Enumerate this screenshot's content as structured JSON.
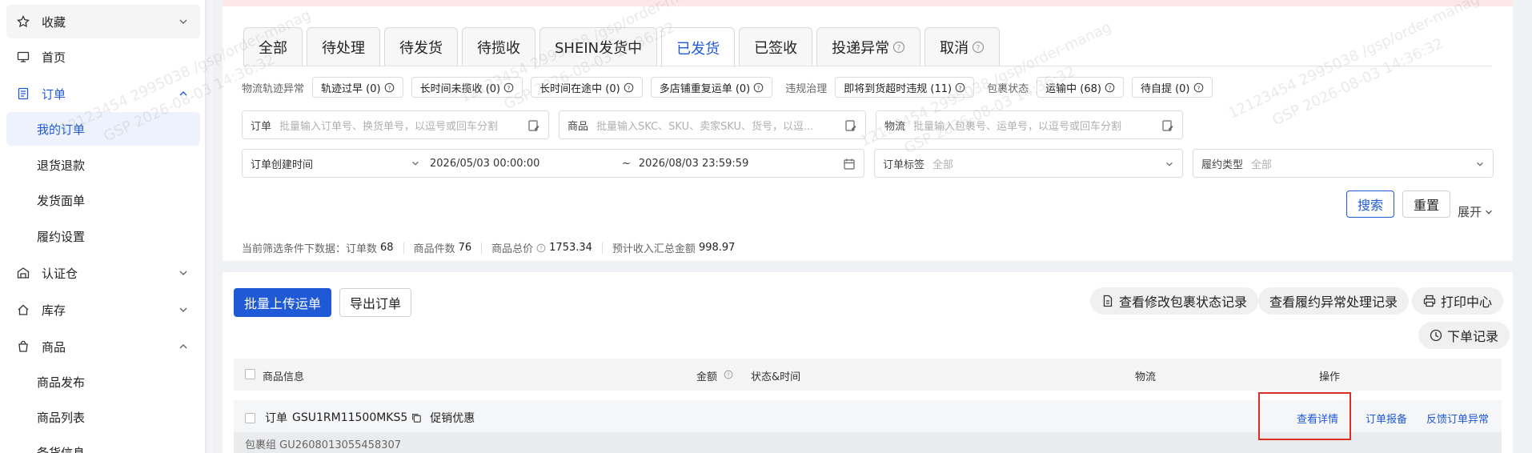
{
  "sidebar": {
    "items": [
      {
        "label": "收藏",
        "icon": "star-icon"
      },
      {
        "label": "首页",
        "icon": "monitor-icon"
      },
      {
        "label": "订单",
        "icon": "order-icon"
      },
      {
        "label": "我的订单"
      },
      {
        "label": "退货退款"
      },
      {
        "label": "发货面单"
      },
      {
        "label": "履约设置"
      },
      {
        "label": "认证仓",
        "icon": "warehouse-icon"
      },
      {
        "label": "库存",
        "icon": "home-icon"
      },
      {
        "label": "商品",
        "icon": "bag-icon"
      },
      {
        "label": "商品发布"
      },
      {
        "label": "商品列表"
      },
      {
        "label": "备货信息"
      }
    ]
  },
  "tabs": [
    "全部",
    "待处理",
    "待发货",
    "待揽收",
    "SHEIN发货中",
    "已发货",
    "已签收",
    "投递异常",
    "取消"
  ],
  "filters": {
    "logistics_label": "物流轨迹异常",
    "chips1": [
      "轨迹过早 (0)",
      "长时间未揽收 (0)",
      "长时间在途中 (0)",
      "多店铺重复运单 (0)"
    ],
    "violation_label": "违规治理",
    "chips2": [
      "即将到货超时违规 (11)"
    ],
    "package_label": "包裹状态",
    "chips3": [
      "运输中 (68)",
      "待自提 (0)"
    ]
  },
  "inputs": {
    "order_label": "订单",
    "order_ph": "批量输入订单号、换货单号，以逗号或回车分割",
    "goods_label": "商品",
    "goods_ph": "批量输入SKC、SKU、卖家SKU、货号，以逗...",
    "logi_label": "物流",
    "logi_ph": "批量输入包裹号、运单号，以逗号或回车分割",
    "date_type": "订单创建时间",
    "date_start": "2026/05/03 00:00:00",
    "date_tilde": "~",
    "date_end": "2026/08/03 23:59:59",
    "tag_label": "订单标签",
    "tag_value": "全部",
    "type_label": "履约类型",
    "type_value": "全部"
  },
  "buttons": {
    "search": "搜索",
    "reset": "重置",
    "expand": "展开"
  },
  "stats": {
    "prefix": "当前筛选条件下数据：",
    "orders_label": "订单数",
    "orders": "68",
    "items_label": "商品件数",
    "items": "76",
    "total_label": "商品总价",
    "total": "1753.34",
    "income_label": "预计收入汇总金额",
    "income": "998.97"
  },
  "actions": {
    "batch_upload": "批量上传运单",
    "export": "导出订单",
    "pkg_log": "查看修改包裹状态记录",
    "exception_log": "查看履约异常处理记录",
    "print": "打印中心",
    "order_log": "下单记录"
  },
  "table": {
    "headers": {
      "goods": "商品信息",
      "amount": "金额",
      "status": "状态&时间",
      "logistics": "物流",
      "ops": "操作"
    },
    "row": {
      "order_prefix": "订单",
      "order_no": "GSU1RM11500MKS5",
      "promo": "促销优惠",
      "detail": "查看详情",
      "report": "订单报备",
      "feedback": "反馈订单异常",
      "package_group": "包裹组 GU2608013055458307"
    }
  },
  "watermark": [
    "12123454 2995038 /gsp/order-manag",
    "GSP 2026-08-03 14:36:32"
  ],
  "colors": {
    "accent": "#1f59d6",
    "highlight": "#d93025"
  }
}
